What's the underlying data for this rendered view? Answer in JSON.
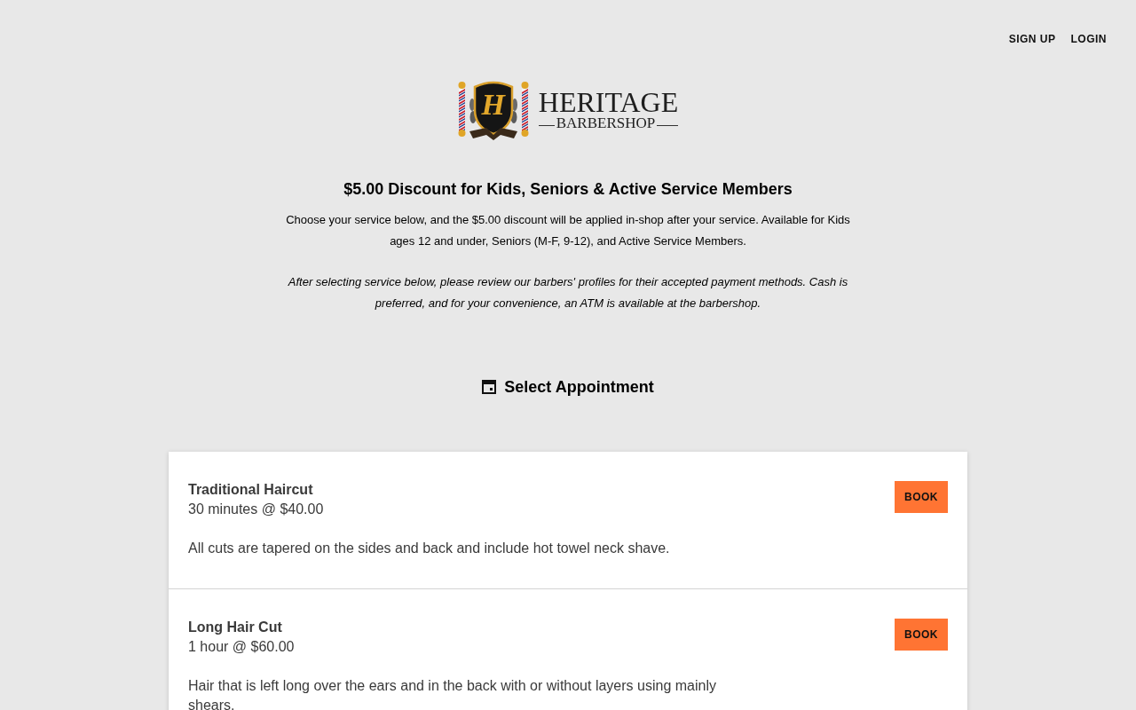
{
  "nav": [
    "SIGN UP",
    "LOGIN"
  ],
  "logo": {
    "monogram": "H",
    "name": "HERITAGE",
    "tagline": "BARBERSHOP"
  },
  "notice": {
    "title": "$5.00 Discount for Kids, Seniors & Active Service Members",
    "paragraphs": [
      {
        "text": "Choose your service below, and the $5.00 discount will be applied in-shop after your service. Available for Kids ages 12 and under, Seniors (M-F, 9-12), and Active Service Members.",
        "italic": false
      },
      {
        "text": "After selecting service below, please review our barbers' profiles for their accepted payment methods. Cash is preferred, and for your convenience, an ATM is available at the barbershop.",
        "italic": true
      }
    ]
  },
  "section_title": "Select Appointment",
  "services": [
    {
      "name": "Traditional Haircut",
      "duration": "30 minutes @ $40.00",
      "description": "All cuts are tapered on the sides and back and include hot towel neck shave.",
      "button": "BOOK"
    },
    {
      "name": "Long Hair Cut",
      "duration": "1 hour @ $60.00",
      "description": "Hair that is left long over the ears and in the back with or without layers using mainly shears.",
      "button": "BOOK"
    }
  ]
}
